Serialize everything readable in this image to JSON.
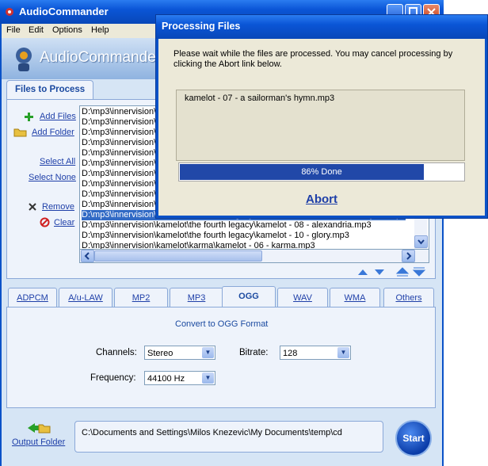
{
  "app": {
    "title": "AudioCommander",
    "logo_text": "AudioCommander"
  },
  "menu": [
    "File",
    "Edit",
    "Options",
    "Help"
  ],
  "files_tab": {
    "label": "Files to Process"
  },
  "actions": {
    "add_files": "Add Files",
    "add_folder": "Add Folder",
    "select_all": "Select All",
    "select_none": "Select None",
    "remove": "Remove",
    "clear": "Clear"
  },
  "file_list": [
    "D:\\mp3\\innervision\\",
    "D:\\mp3\\innervision\\",
    "D:\\mp3\\innervision\\",
    "D:\\mp3\\innervision\\",
    "D:\\mp3\\innervision\\",
    "D:\\mp3\\innervision\\",
    "D:\\mp3\\innervision\\",
    "D:\\mp3\\innervision\\",
    "D:\\mp3\\innervision\\",
    "D:\\mp3\\innervision\\",
    "D:\\mp3\\innervision\\kamelot\\the fourth legacy\\kamelot - 07 - a sailorman's hymn.mp3",
    "D:\\mp3\\innervision\\kamelot\\the fourth legacy\\kamelot - 08 - alexandria.mp3",
    "D:\\mp3\\innervision\\kamelot\\the fourth legacy\\kamelot - 10 - glory.mp3",
    "D:\\mp3\\innervision\\kamelot\\karma\\kamelot - 06 - karma.mp3"
  ],
  "selected_row": 10,
  "format_tabs": [
    "ADPCM",
    "A/u-LAW",
    "MP2",
    "MP3",
    "OGG",
    "WAV",
    "WMA",
    "Others"
  ],
  "active_format": "OGG",
  "format_panel": {
    "heading": "Convert to OGG Format",
    "channels_label": "Channels:",
    "channels_value": "Stereo",
    "bitrate_label": "Bitrate:",
    "bitrate_value": "128",
    "frequency_label": "Frequency:",
    "frequency_value": "44100 Hz"
  },
  "output": {
    "label": "Output Folder",
    "path": "C:\\Documents and Settings\\Milos Knezevic\\My Documents\\temp\\cd"
  },
  "start_label": "Start",
  "dialog": {
    "title": "Processing Files",
    "message": "Please wait while the files are processed.  You may cancel processing by clicking the Abort link below.",
    "current_file": "kamelot - 07 - a sailorman's hymn.mp3",
    "progress_fraction": 0.86,
    "progress_text": "86% Done",
    "abort_label": "Abort"
  },
  "colors": {
    "accent": "#0a52c8",
    "progress": "#2148a8",
    "link": "#1e3fa8",
    "selection": "#316ac5"
  }
}
